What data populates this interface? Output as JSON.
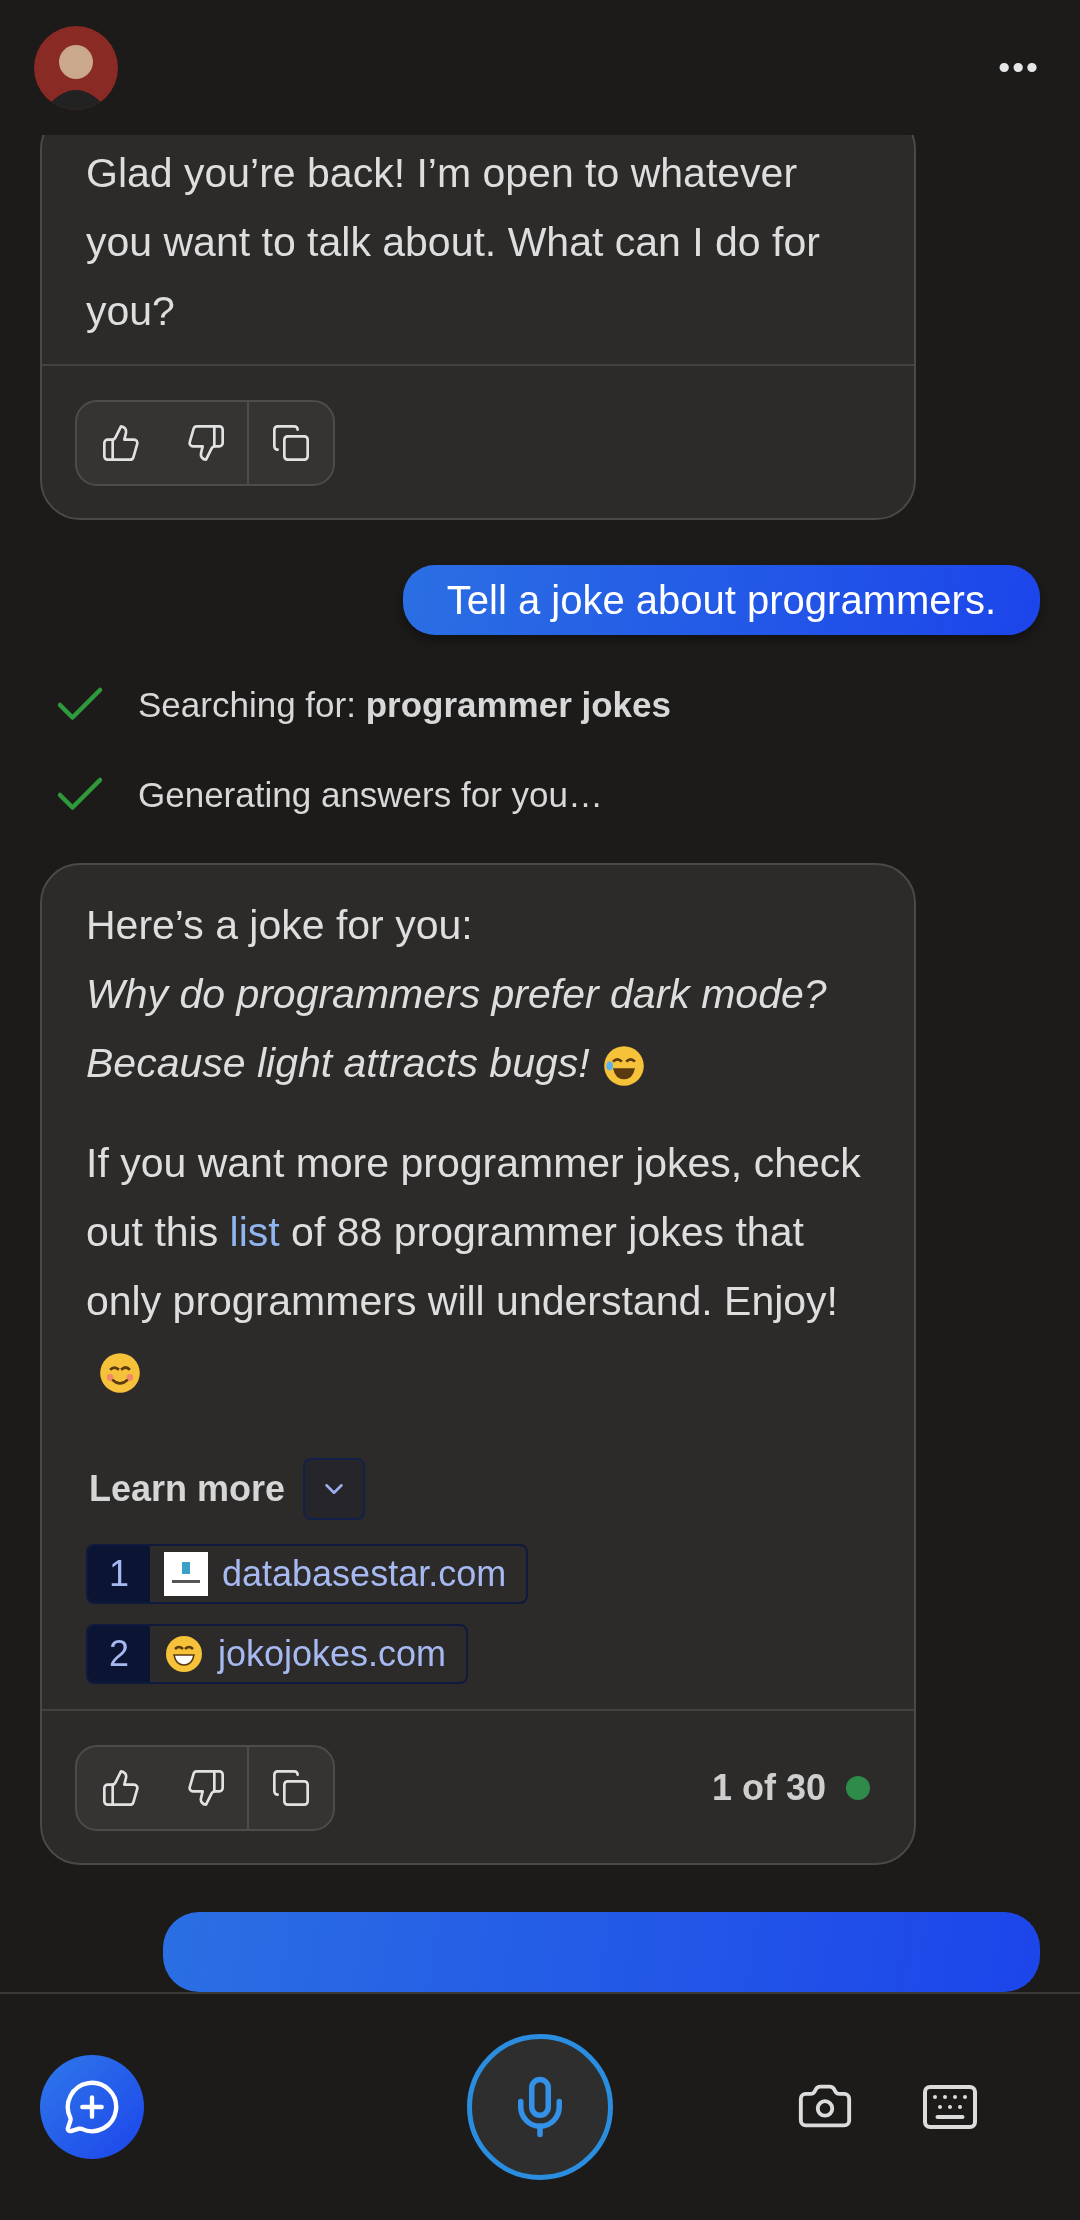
{
  "header": {
    "menu_label": "•••"
  },
  "messages": [
    {
      "kind": "bot",
      "paragraphs": [
        {
          "kind": "plain",
          "text": "Glad you’re back! I’m open to whatever you want to talk about. What can I do for you?"
        }
      ]
    },
    {
      "kind": "user",
      "text": "Tell a joke about programmers."
    },
    {
      "kind": "status",
      "steps": [
        {
          "text": "Searching for: **programmer jokes**",
          "done": true
        },
        {
          "text": "Generating answers for you…",
          "done": true
        }
      ]
    },
    {
      "kind": "bot",
      "paragraphs": [
        {
          "kind": "plain",
          "text": "Here’s a joke for you:"
        },
        {
          "kind": "italic",
          "text": "Why do programmers prefer dark mode? Because light attracts bugs!",
          "end_icon": {
            "kind": "laughing"
          }
        },
        {
          "kind": "link",
          "before": "If you want more programmer jokes, check out this ",
          "link": "list",
          "after": " of 88 programmer jokes that only programmers will understand. Enjoy!",
          "end_icon": {
            "kind": "smiling"
          }
        }
      ],
      "learn_more": {
        "label": "Learn more",
        "expanded": false,
        "sources": [
          {
            "number": "1",
            "site": "databasestar.com",
            "kind": "logo"
          },
          {
            "number": "2",
            "site": "jokojokes.com",
            "kind": "emoji"
          }
        ]
      },
      "counter": "1 of 30"
    },
    {
      "kind": "user_partial"
    }
  ]
}
